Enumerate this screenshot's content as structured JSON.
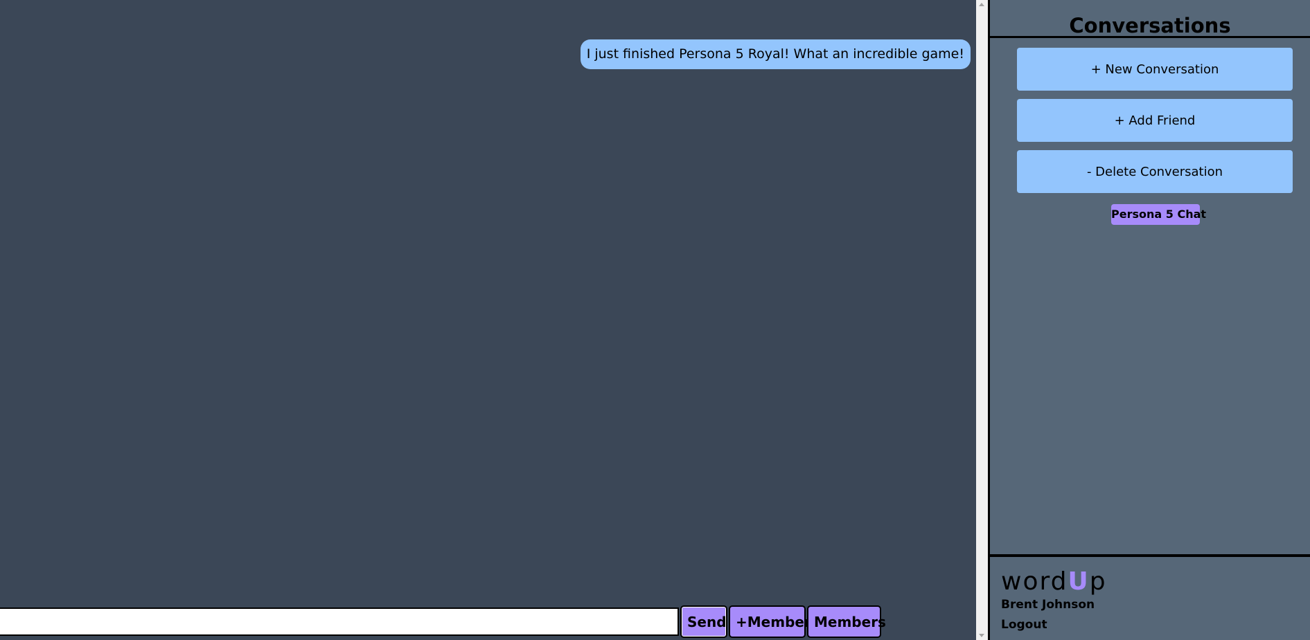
{
  "colors": {
    "chat_background": "#3b4757",
    "sidebar_background": "#566778",
    "message_bubble": "#93c5fd",
    "button_blue": "#93c5fd",
    "button_purple": "#a78bfa",
    "logo_accent": "#a78bfa"
  },
  "chat": {
    "messages": [
      {
        "text": "I just finished Persona 5 Royal! What an incredible game!",
        "side": "right"
      }
    ],
    "input": {
      "value": "",
      "placeholder": ""
    },
    "buttons": {
      "send": "Send",
      "add_member": "+Member",
      "members": "Members"
    }
  },
  "sidebar": {
    "title": "Conversations",
    "new_conversation": "+ New Conversation",
    "add_friend": "+ Add Friend",
    "delete_conversation": "- Delete Conversation",
    "conversations": [
      {
        "name": "Persona 5 Chat"
      }
    ],
    "footer": {
      "logo_prefix": "word",
      "logo_accent": "U",
      "logo_suffix": "p",
      "username": "Brent Johnson",
      "logout": "Logout"
    }
  }
}
